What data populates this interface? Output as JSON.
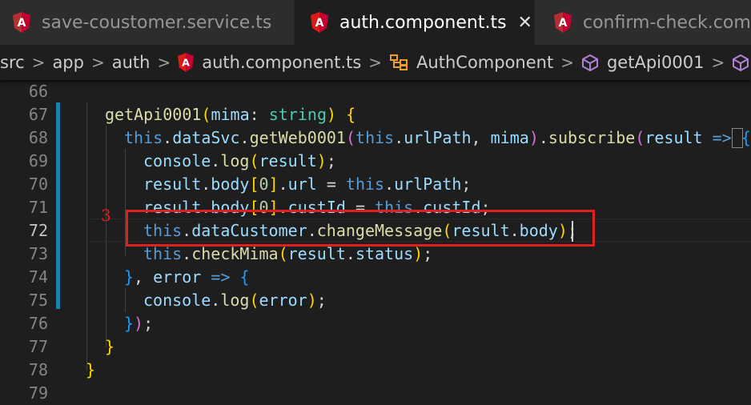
{
  "tabs": [
    {
      "label": "save-coustomer.service.ts",
      "icon": "angular-icon",
      "active": false
    },
    {
      "label": "auth.component.ts",
      "icon": "angular-icon",
      "active": true
    },
    {
      "label": "confirm-check.comp",
      "icon": "angular-icon",
      "active": false
    }
  ],
  "close_glyph": "✕",
  "breadcrumb": {
    "items": [
      "src",
      "app",
      "auth",
      "auth.component.ts",
      "AuthComponent",
      "getApi0001"
    ],
    "separator": ">"
  },
  "annotation": {
    "label": "3",
    "color": "#e0201f"
  },
  "editor": {
    "line_numbers": [
      "66",
      "67",
      "68",
      "69",
      "70",
      "71",
      "72",
      "73",
      "74",
      "75",
      "76",
      "77",
      "78",
      "79"
    ],
    "lines": [
      "",
      "getApi0001(mima: string) {",
      "  this.dataSvc.getWeb0001(this.urlPath, mima).subscribe(result => {",
      "    console.log(result);",
      "    result.body[0].url = this.urlPath;",
      "    result.body[0].custId = this.custId;",
      "    this.dataCustomer.changeMessage(result.body);",
      "    this.checkMima(result.status);",
      "  }, error => {",
      "    console.log(error);",
      "  });",
      "}",
      "}",
      ""
    ]
  },
  "colors": {
    "background": "#1e1e1e",
    "keyword": "#569cd6",
    "function": "#dcdcaa",
    "property": "#9cdcfe",
    "type": "#4ec9b0",
    "gutter_modified": "#1b81a8",
    "angular": "#dd1b16"
  }
}
